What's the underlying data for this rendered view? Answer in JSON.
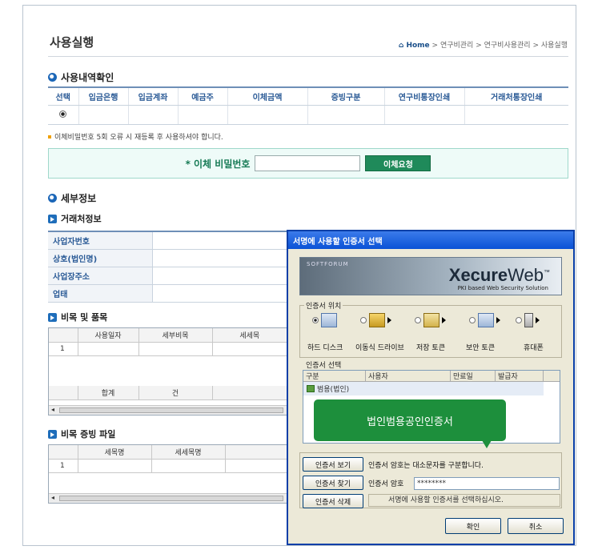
{
  "page": {
    "title": "사용실행",
    "breadcrumb": {
      "home": "Home",
      "items": [
        "연구비관리",
        "연구비사용관리",
        "사용실행"
      ]
    }
  },
  "usage_section": {
    "title": "사용내역확인",
    "columns": [
      "선택",
      "입금은행",
      "입금계좌",
      "예금주",
      "이체금액",
      "증빙구분",
      "연구비통장인쇄",
      "거래처통장인쇄"
    ]
  },
  "notice": "이체비밀번호 5회 오류 시 재등록 후 사용하셔야 합니다.",
  "transfer": {
    "label": "* 이체 비밀번호",
    "button": "이체요청",
    "value": ""
  },
  "detail_section": {
    "title": "세부정보"
  },
  "vendor_section": {
    "title": "거래처정보",
    "rows": [
      "사업자번호",
      "상호(법인명)",
      "사업장주소",
      "업태"
    ]
  },
  "expense_section": {
    "title": "비목 및 품목",
    "columns": [
      "사용일자",
      "세부비목",
      "세세목"
    ],
    "row_no": "1",
    "sum_label": "합계",
    "sum_unit": "건"
  },
  "evidence_section": {
    "title": "비목 증빙 파일",
    "columns": [
      "세목명",
      "세세목명"
    ],
    "row_no": "1"
  },
  "dialog": {
    "title": "서명에 사용할 인증서 선택",
    "brand_small": "SOFTFORUM",
    "brand_main_bold": "Xecure",
    "brand_main": "Web",
    "brand_tm": "™",
    "brand_sub": "PKI based Web Security Solution",
    "location_group": "인증서 위치",
    "devices": [
      "하드 디스크",
      "이동식 드라이브",
      "저장 토큰",
      "보안 토큰",
      "휴대폰"
    ],
    "select_group": "인증서 선택",
    "list_columns": [
      "구분",
      "사용자",
      "만료일",
      "발급자"
    ],
    "cert_item": "범용(법인)",
    "callout": "법인범용공인인증서",
    "view_button": "인증서 보기",
    "view_note": "인증서 암호는 대소문자를 구분합니다.",
    "find_button": "인증서 찾기",
    "password_label": "인증서 암호",
    "password_value": "********",
    "delete_button": "인증서 삭제",
    "hint": "서명에 사용할 인증서를 선택하십시오.",
    "ok": "확인",
    "cancel": "취소"
  }
}
